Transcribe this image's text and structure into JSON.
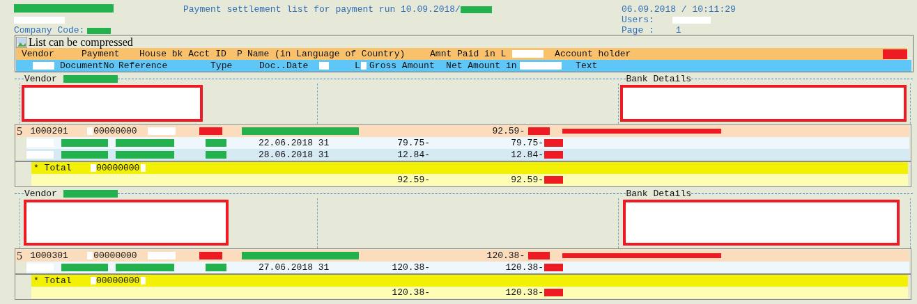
{
  "header": {
    "title": "Payment settlement list for payment run 10.09.2018/",
    "company_code_label": "Company Code:",
    "datetime": "06.09.2018 / 10:11:29",
    "users_label": "Users:",
    "page_label": "Page :",
    "page": "1"
  },
  "list_header": {
    "note": "List can be compressed",
    "columns_1": [
      "Vendor",
      "Payment",
      "House bk Acct ID",
      "P",
      "Name (in Language of Country)",
      "Amnt Paid in L",
      "Account holder"
    ],
    "columns_2": [
      "DocumentNo",
      "Reference",
      "Type",
      "Doc..Date",
      "L",
      "Gross Amount",
      "Net Amount in",
      "Text"
    ]
  },
  "sections": [
    {
      "vendor_label": "Vendor",
      "bank_label": "Bank Details",
      "rows": [
        {
          "kind": "vendor",
          "flag": "5",
          "vendor": "1000201",
          "payment": "00000000",
          "amount": "92.59-"
        },
        {
          "kind": "item",
          "date": "22.06.2018 31",
          "gross": "79.75-",
          "net": "79.75-"
        },
        {
          "kind": "item",
          "date": "28.06.2018 31",
          "gross": "12.84-",
          "net": "12.84-"
        },
        {
          "kind": "total",
          "label": "* Total",
          "payment": "00000000"
        },
        {
          "kind": "sum",
          "gross": "92.59-",
          "net": "92.59-"
        }
      ]
    },
    {
      "vendor_label": "Vendor",
      "bank_label": "Bank Details",
      "rows": [
        {
          "kind": "vendor",
          "flag": "5",
          "vendor": "1000301",
          "payment": "00000000",
          "amount": "120.38-"
        },
        {
          "kind": "item",
          "date": "27.06.2018 31",
          "gross": "120.38-",
          "net": "120.38-"
        },
        {
          "kind": "total",
          "label": "* Total",
          "payment": "00000000"
        },
        {
          "kind": "sum",
          "gross": "120.38-",
          "net": "120.38-"
        }
      ]
    }
  ]
}
